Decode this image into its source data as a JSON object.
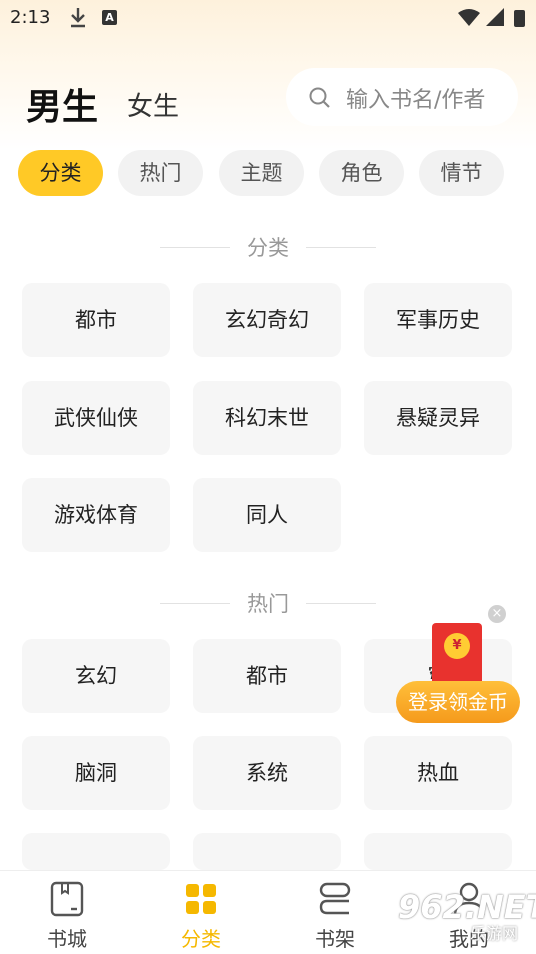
{
  "status_bar": {
    "time": "2:13",
    "download_icon": "download-icon",
    "notif_icon": "A"
  },
  "header": {
    "gender_tabs": [
      {
        "label": "男生",
        "active": true
      },
      {
        "label": "女生",
        "active": false
      }
    ],
    "search": {
      "placeholder": "输入书名/作者",
      "icon": "search-icon"
    }
  },
  "filter_chips": [
    {
      "label": "分类",
      "active": true
    },
    {
      "label": "热门",
      "active": false
    },
    {
      "label": "主题",
      "active": false
    },
    {
      "label": "角色",
      "active": false
    },
    {
      "label": "情节",
      "active": false
    }
  ],
  "sections": [
    {
      "title": "分类",
      "items": [
        "都市",
        "玄幻奇幻",
        "军事历史",
        "武侠仙侠",
        "科幻末世",
        "悬疑灵异",
        "游戏体育",
        "同人"
      ]
    },
    {
      "title": "热门",
      "items": [
        "玄幻",
        "都市",
        "穿",
        "脑洞",
        "系统",
        "热血"
      ]
    }
  ],
  "floating_promo": {
    "label": "登录领金币",
    "coin_symbol": "¥",
    "close": "×"
  },
  "tab_bar": [
    {
      "label": "书城",
      "icon": "book-city-icon",
      "active": false
    },
    {
      "label": "分类",
      "icon": "category-grid-icon",
      "active": true
    },
    {
      "label": "书架",
      "icon": "bookshelf-icon",
      "active": false
    },
    {
      "label": "我的",
      "icon": "profile-icon",
      "active": false
    }
  ],
  "watermark": {
    "main": "962.NET",
    "sub": "乐游网"
  },
  "colors": {
    "accent": "#ffc926",
    "tab_active": "#f5b800",
    "card_bg": "#f6f6f6",
    "promo": "#f59a1c"
  }
}
